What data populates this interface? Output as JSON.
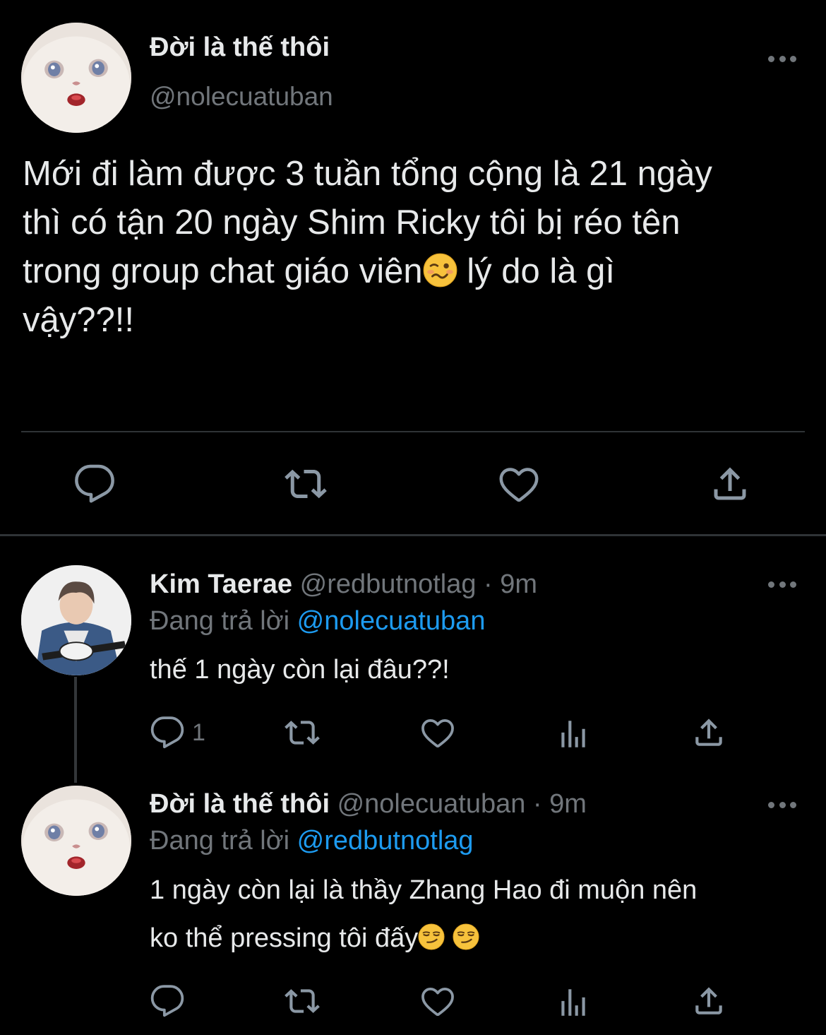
{
  "main_tweet": {
    "author_name": "Đời là thế thôi",
    "author_handle": "@nolecuatuban",
    "text_line1": "Mới đi làm được 3 tuần tổng cộng là 21 ngày",
    "text_line2": "thì có tận 20 ngày Shim Ricky tôi bị réo tên",
    "text_line3a": "trong group chat giáo viên",
    "text_line3b": "lý do là gì",
    "text_line4": "vậy??!!"
  },
  "reply1": {
    "author_name": "Kim Taerae",
    "author_handle": "@redbutnotlag",
    "time": "· 9m",
    "replying_label": "Đang trả lời",
    "replying_to": "@nolecuatuban",
    "text": "thế 1 ngày còn lại đâu??!",
    "reply_count": "1"
  },
  "reply2": {
    "author_name": "Đời là thế thôi",
    "author_handle": "@nolecuatuban",
    "time": "· 9m",
    "replying_label": "Đang trả lời",
    "replying_to": "@redbutnotlag",
    "text_line1": "1 ngày còn lại là thầy Zhang Hao đi muộn nên",
    "text_line2": "ko thể pressing tôi đấy"
  },
  "colors": {
    "background": "#000000",
    "text": "#e7e9ea",
    "secondary": "#71767b",
    "link": "#1d9bf0",
    "divider": "#2f3336"
  },
  "icons": [
    "more-icon",
    "reply-icon",
    "retweet-icon",
    "like-icon",
    "share-icon",
    "analytics-icon",
    "woozy-face-emoji",
    "smirking-face-emoji"
  ]
}
